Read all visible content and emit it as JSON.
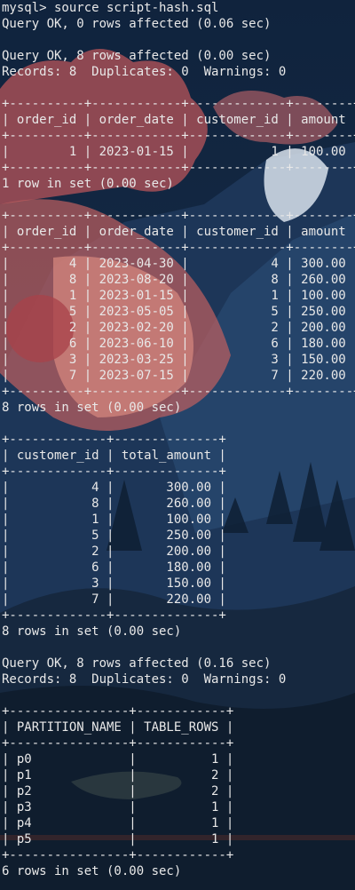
{
  "terminal": {
    "lines": [
      "mysql> source script-hash.sql",
      "Query OK, 0 rows affected (0.06 sec)",
      "",
      "Query OK, 8 rows affected (0.00 sec)",
      "Records: 8  Duplicates: 0  Warnings: 0",
      "",
      "+----------+------------+-------------+--------+",
      "| order_id | order_date | customer_id | amount |",
      "+----------+------------+-------------+--------+",
      "|        1 | 2023-01-15 |           1 | 100.00 |",
      "+----------+------------+-------------+--------+",
      "1 row in set (0.00 sec)",
      "",
      "+----------+------------+-------------+--------+",
      "| order_id | order_date | customer_id | amount |",
      "+----------+------------+-------------+--------+",
      "|        4 | 2023-04-30 |           4 | 300.00 |",
      "|        8 | 2023-08-20 |           8 | 260.00 |",
      "|        1 | 2023-01-15 |           1 | 100.00 |",
      "|        5 | 2023-05-05 |           5 | 250.00 |",
      "|        2 | 2023-02-20 |           2 | 200.00 |",
      "|        6 | 2023-06-10 |           6 | 180.00 |",
      "|        3 | 2023-03-25 |           3 | 150.00 |",
      "|        7 | 2023-07-15 |           7 | 220.00 |",
      "+----------+------------+-------------+--------+",
      "8 rows in set (0.00 sec)",
      "",
      "+-------------+--------------+",
      "| customer_id | total_amount |",
      "+-------------+--------------+",
      "|           4 |       300.00 |",
      "|           8 |       260.00 |",
      "|           1 |       100.00 |",
      "|           5 |       250.00 |",
      "|           2 |       200.00 |",
      "|           6 |       180.00 |",
      "|           3 |       150.00 |",
      "|           7 |       220.00 |",
      "+-------------+--------------+",
      "8 rows in set (0.00 sec)",
      "",
      "Query OK, 8 rows affected (0.16 sec)",
      "Records: 8  Duplicates: 0  Warnings: 0",
      "",
      "+----------------+------------+",
      "| PARTITION_NAME | TABLE_ROWS |",
      "+----------------+------------+",
      "| p0             |          1 |",
      "| p1             |          2 |",
      "| p2             |          2 |",
      "| p3             |          1 |",
      "| p4             |          1 |",
      "| p5             |          1 |",
      "+----------------+------------+",
      "6 rows in set (0.00 sec)"
    ]
  }
}
